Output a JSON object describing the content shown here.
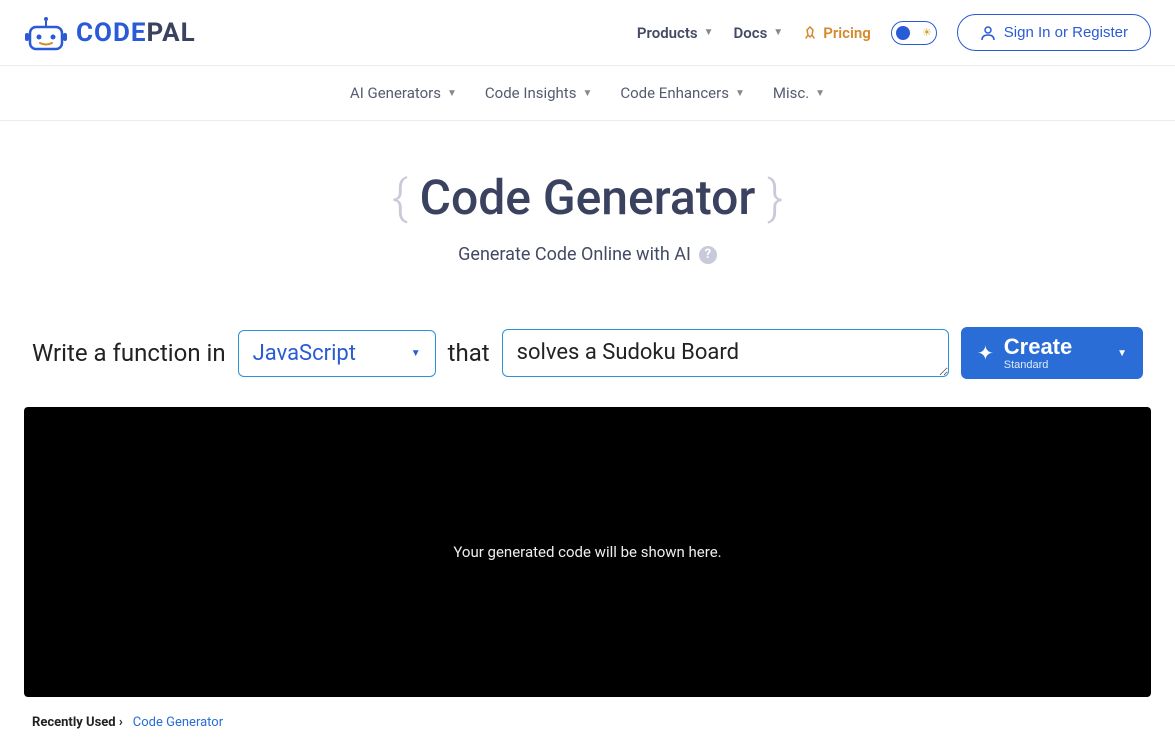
{
  "brand": {
    "code": "CODE",
    "pal": "PAL"
  },
  "nav": {
    "products": "Products",
    "docs": "Docs",
    "pricing": "Pricing",
    "signin": "Sign In or Register"
  },
  "subnav": {
    "ai_generators": "AI Generators",
    "code_insights": "Code Insights",
    "code_enhancers": "Code Enhancers",
    "misc": "Misc."
  },
  "page": {
    "title": "Code Generator",
    "subtitle": "Generate Code Online with AI"
  },
  "form": {
    "prefix": "Write a function in",
    "language": "JavaScript",
    "mid": "that",
    "prompt_value": "solves a Sudoku Board",
    "create_label": "Create",
    "create_sub": "Standard"
  },
  "output": {
    "placeholder": "Your generated code will be shown here."
  },
  "footer": {
    "label": "Recently Used ›",
    "link": "Code Generator"
  }
}
